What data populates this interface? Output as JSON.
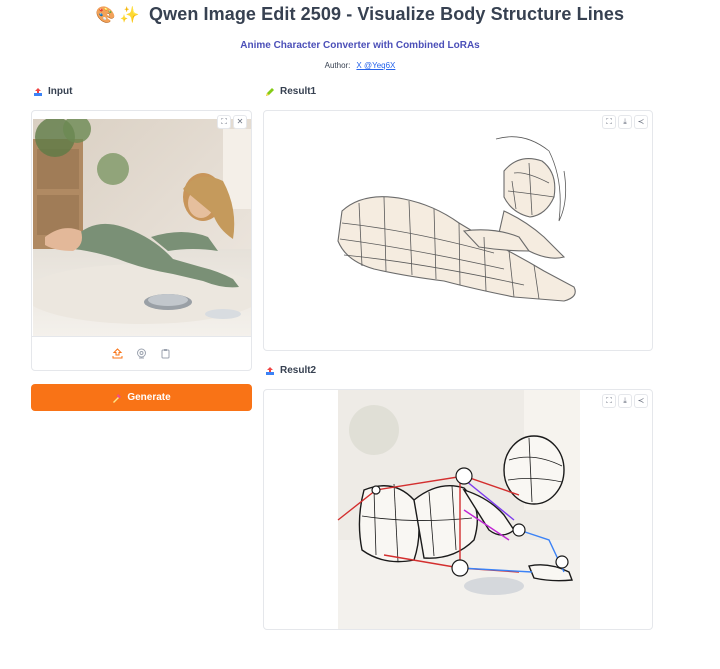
{
  "header": {
    "title": "Qwen Image Edit 2509 - Visualize Body Structure Lines",
    "title_emoji_1": "🎨",
    "title_emoji_2": "✨",
    "subtitle": "Anime Character Converter with Combined LoRAs",
    "author_label": "Author:",
    "author_link": "X @Yeq6X"
  },
  "input": {
    "label": "Input",
    "label_icon": "upload-tray-icon",
    "toolbar_icons": [
      "fullscreen-icon",
      "close-icon"
    ],
    "bottom_icons": [
      "upload-icon",
      "webcam-icon",
      "clipboard-icon"
    ]
  },
  "generate": {
    "label": "Generate",
    "icon": "sparkle-gem-icon"
  },
  "result1": {
    "label": "Result1",
    "label_icon": "pencil-icon",
    "toolbar_icons": [
      "fullscreen-icon",
      "download-icon",
      "share-icon"
    ]
  },
  "result2": {
    "label": "Result2",
    "label_icon": "upload-tray-icon",
    "toolbar_icons": [
      "fullscreen-icon",
      "download-icon",
      "share-icon"
    ]
  },
  "colors": {
    "accent": "#f97316",
    "subtitle": "#4b4fb8",
    "link": "#2563eb",
    "border": "#e5e7eb"
  }
}
